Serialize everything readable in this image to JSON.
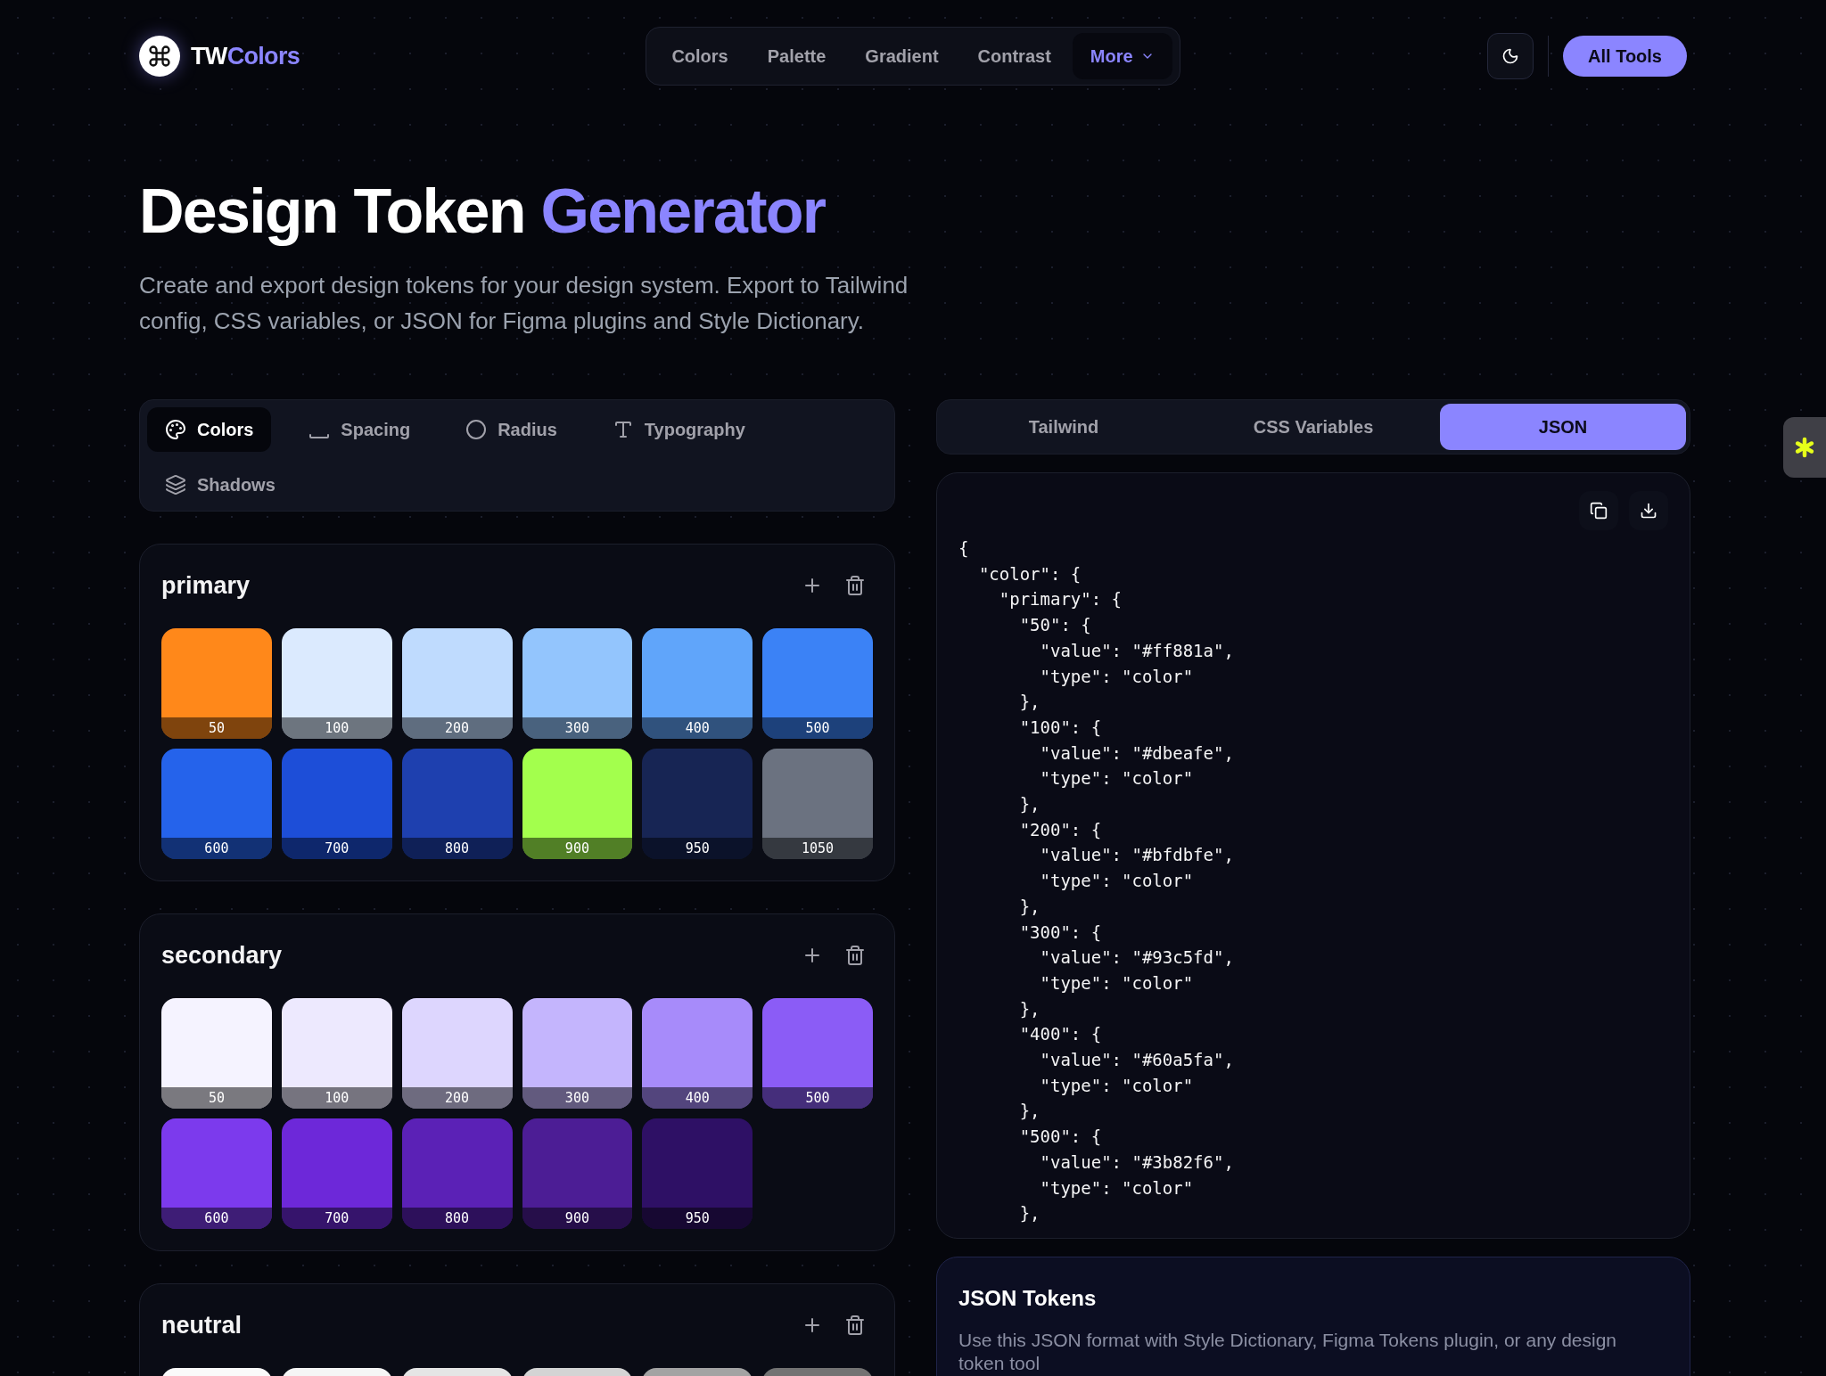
{
  "logo": {
    "prefix": "TW",
    "suffix": "Colors"
  },
  "nav": [
    {
      "label": "Colors",
      "selected": false,
      "kind": "link"
    },
    {
      "label": "Palette",
      "selected": false,
      "kind": "link"
    },
    {
      "label": "Gradient",
      "selected": false,
      "kind": "link"
    },
    {
      "label": "Contrast",
      "selected": false,
      "kind": "link"
    },
    {
      "label": "More",
      "selected": true,
      "kind": "dropdown"
    }
  ],
  "header_button": "All Tools",
  "hero": {
    "title": "Design Token",
    "title_accent": "Generator",
    "description": "Create and export design tokens for your design system. Export to Tailwind config, CSS variables, or JSON for Figma plugins and Style Dictionary."
  },
  "token_tabs": [
    {
      "label": "Colors",
      "kind": "colors",
      "selected": true
    },
    {
      "label": "Spacing",
      "kind": "spacing",
      "selected": false
    },
    {
      "label": "Radius",
      "kind": "radius",
      "selected": false
    },
    {
      "label": "Typography",
      "kind": "typography",
      "selected": false
    },
    {
      "label": "Shadows",
      "kind": "shadows",
      "selected": false
    }
  ],
  "palettes": [
    {
      "name": "primary",
      "swatches": [
        {
          "label": "50",
          "color": "#ff881a"
        },
        {
          "label": "100",
          "color": "#dbeafe"
        },
        {
          "label": "200",
          "color": "#bfdbfe"
        },
        {
          "label": "300",
          "color": "#93c5fd"
        },
        {
          "label": "400",
          "color": "#60a5fa"
        },
        {
          "label": "500",
          "color": "#3b82f6"
        },
        {
          "label": "600",
          "color": "#2563eb"
        },
        {
          "label": "700",
          "color": "#1d4ed8"
        },
        {
          "label": "800",
          "color": "#1e40af"
        },
        {
          "label": "900",
          "color": "#a3ff4d"
        },
        {
          "label": "950",
          "color": "#172554"
        },
        {
          "label": "1050",
          "color": "#6b7280"
        }
      ]
    },
    {
      "name": "secondary",
      "swatches": [
        {
          "label": "50",
          "color": "#f5f3ff"
        },
        {
          "label": "100",
          "color": "#ede9fe"
        },
        {
          "label": "200",
          "color": "#ddd6fe"
        },
        {
          "label": "300",
          "color": "#c4b5fd"
        },
        {
          "label": "400",
          "color": "#a78bfa"
        },
        {
          "label": "500",
          "color": "#8b5cf6"
        },
        {
          "label": "600",
          "color": "#7c3aed"
        },
        {
          "label": "700",
          "color": "#6d28d9"
        },
        {
          "label": "800",
          "color": "#5b21b6"
        },
        {
          "label": "900",
          "color": "#4c1d95"
        },
        {
          "label": "950",
          "color": "#2e1065"
        }
      ]
    },
    {
      "name": "neutral",
      "swatches": [
        {
          "color": "#fafafa"
        },
        {
          "color": "#f5f5f5"
        },
        {
          "color": "#e5e5e5"
        },
        {
          "color": "#d4d4d4"
        },
        {
          "color": "#a3a3a3"
        },
        {
          "color": "#737373"
        }
      ]
    }
  ],
  "export_tabs": [
    {
      "label": "Tailwind",
      "selected": false
    },
    {
      "label": "CSS Variables",
      "selected": false
    },
    {
      "label": "JSON",
      "selected": true
    }
  ],
  "code_lines": [
    "{",
    "  \"color\": {",
    "    \"primary\": {",
    "      \"50\": {",
    "        \"value\": \"#ff881a\",",
    "        \"type\": \"color\"",
    "      },",
    "      \"100\": {",
    "        \"value\": \"#dbeafe\",",
    "        \"type\": \"color\"",
    "      },",
    "      \"200\": {",
    "        \"value\": \"#bfdbfe\",",
    "        \"type\": \"color\"",
    "      },",
    "      \"300\": {",
    "        \"value\": \"#93c5fd\",",
    "        \"type\": \"color\"",
    "      },",
    "      \"400\": {",
    "        \"value\": \"#60a5fa\",",
    "        \"type\": \"color\"",
    "      },",
    "      \"500\": {",
    "        \"value\": \"#3b82f6\",",
    "        \"type\": \"color\"",
    "      },"
  ],
  "info": {
    "title": "JSON Tokens",
    "text": "Use this JSON format with Style Dictionary, Figma Tokens plugin, or any design token tool"
  }
}
